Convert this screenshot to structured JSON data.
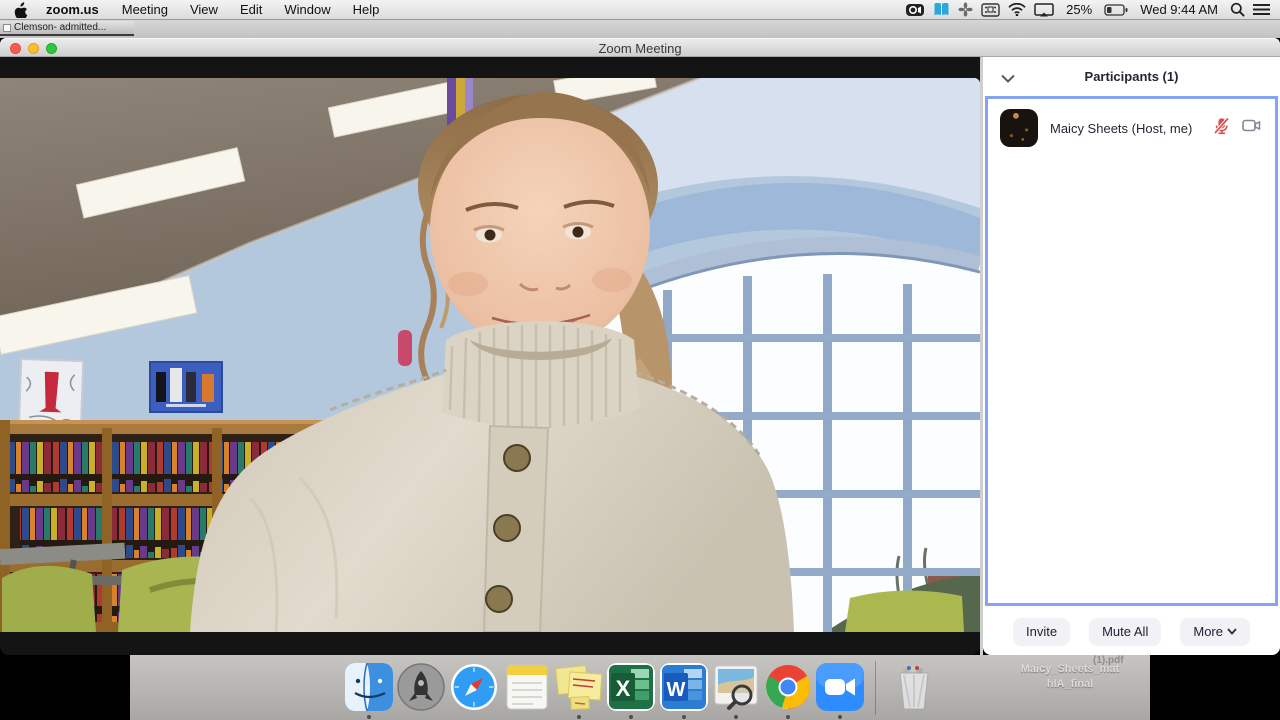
{
  "menu_bar": {
    "app_menu": "zoom.us",
    "menus": [
      "Meeting",
      "View",
      "Edit",
      "Window",
      "Help"
    ],
    "battery_percent": "25%",
    "clock": "Wed 9:44 AM"
  },
  "background_window": {
    "tab_label": "Clemson- admitted..."
  },
  "zoom_window": {
    "title": "Zoom Meeting"
  },
  "participants_panel": {
    "header": "Participants (1)",
    "participant": {
      "name": "Maicy Sheets (Host, me)",
      "audio_state": "muted",
      "video_state": "on"
    },
    "buttons": {
      "invite": "Invite",
      "mute_all": "Mute All",
      "more": "More"
    }
  },
  "desktop": {
    "file_label_line1": "Maicy_Sheets_mat",
    "file_label_line2": "hIA_final",
    "partial_label": "(1).pdf"
  },
  "dock": {
    "items": [
      "finder",
      "launchpad",
      "safari",
      "notes",
      "stickies",
      "excel",
      "word",
      "preview",
      "chrome",
      "zoom",
      "trash"
    ],
    "running": [
      "finder",
      "stickies",
      "excel",
      "word",
      "preview",
      "chrome",
      "zoom"
    ],
    "excel_glyph": "X",
    "word_glyph": "W"
  },
  "video": {
    "description": "webcam view of participant in school library"
  },
  "colors": {
    "focus_ring": "#84a3f2",
    "muted_mic": "#e04f4f"
  }
}
